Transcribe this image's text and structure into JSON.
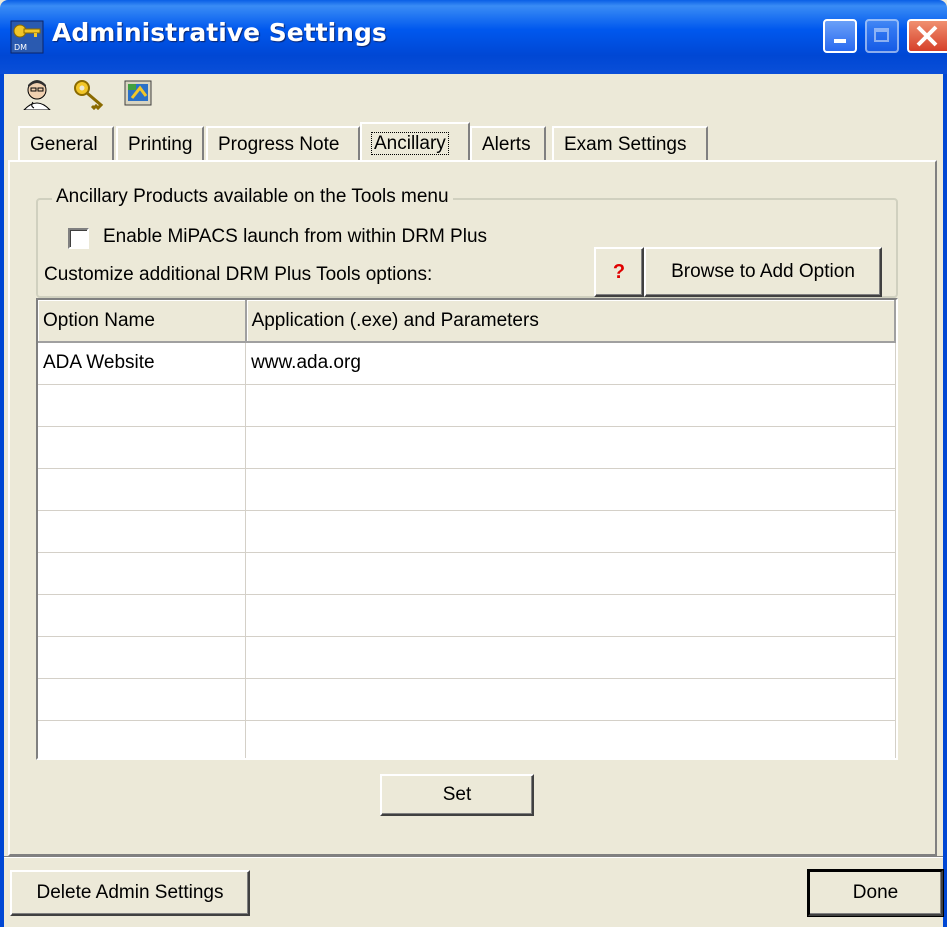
{
  "window": {
    "title": "Administrative Settings"
  },
  "toolbar": {
    "icons": [
      "doctor-icon",
      "key-icon",
      "monitor-icon"
    ]
  },
  "tabs": [
    {
      "label": "General",
      "active": false
    },
    {
      "label": "Printing",
      "active": false
    },
    {
      "label": "Progress Note",
      "active": false
    },
    {
      "label": "Ancillary",
      "active": true
    },
    {
      "label": "Alerts",
      "active": false
    },
    {
      "label": "Exam Settings",
      "active": false
    }
  ],
  "ancillary": {
    "group_label": "Ancillary Products available on the Tools menu",
    "mipacs_checkbox": {
      "label": "Enable MiPACS launch from within DRM Plus",
      "checked": false
    },
    "customize_label": "Customize additional DRM Plus Tools options:",
    "help_button": "?",
    "browse_button": "Browse to Add Option",
    "grid": {
      "columns": [
        "Option Name",
        "Application (.exe) and Parameters"
      ],
      "rows": [
        [
          "ADA Website",
          "www.ada.org"
        ],
        [
          "",
          ""
        ],
        [
          "",
          ""
        ],
        [
          "",
          ""
        ],
        [
          "",
          ""
        ],
        [
          "",
          ""
        ],
        [
          "",
          ""
        ],
        [
          "",
          ""
        ],
        [
          "",
          ""
        ],
        [
          "",
          ""
        ]
      ]
    },
    "set_button": "Set"
  },
  "footer": {
    "delete_button": "Delete Admin Settings",
    "done_button": "Done"
  },
  "colors": {
    "titlebar": "#0058ee",
    "dialog_bg": "#ece9d8",
    "help_mark": "#e00000"
  }
}
